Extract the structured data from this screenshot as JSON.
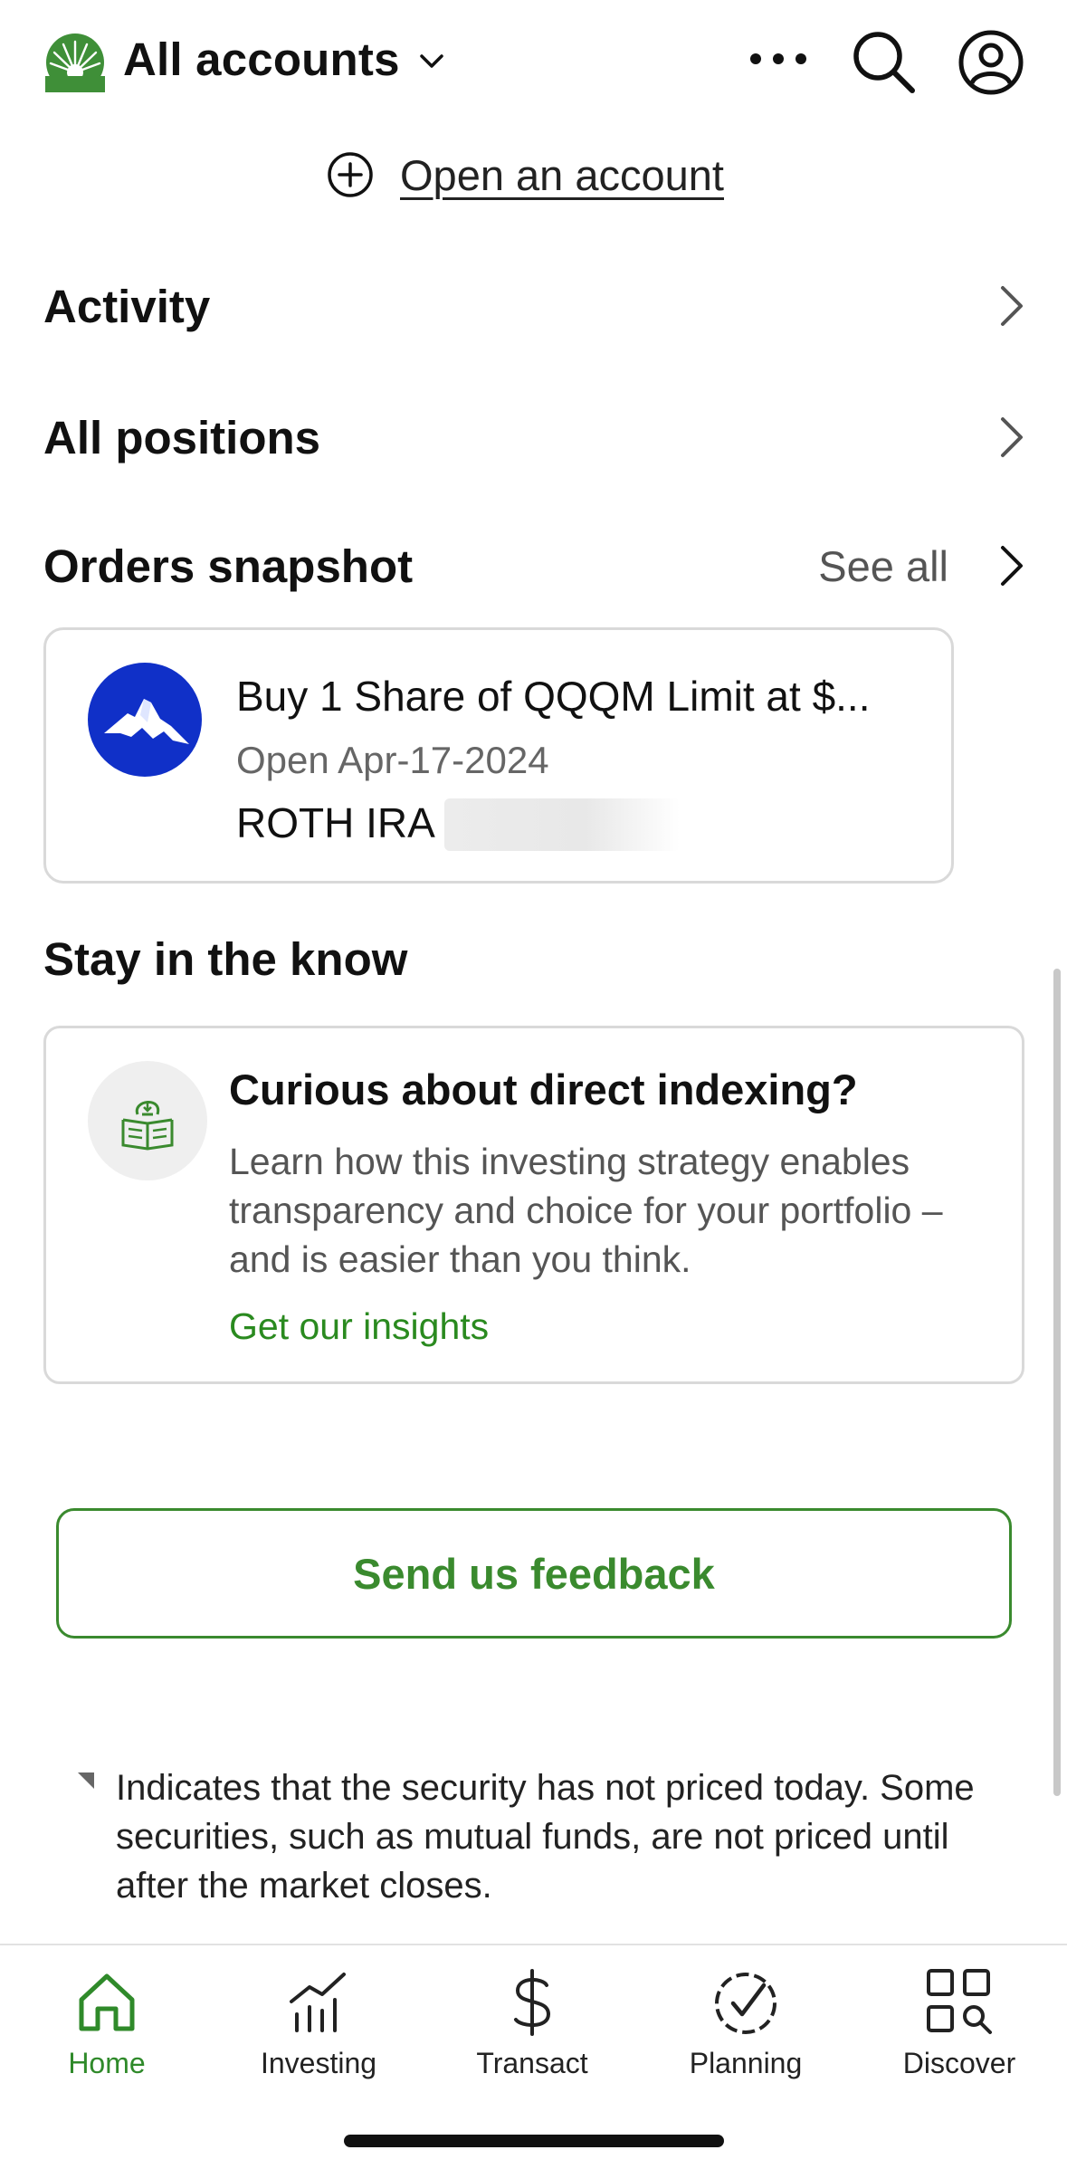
{
  "header": {
    "account_selector": "All accounts",
    "icons": [
      "logo-icon",
      "chevron-down-icon",
      "more-icon",
      "search-icon",
      "profile-icon"
    ]
  },
  "open_account": {
    "label": "Open an account"
  },
  "rows": {
    "activity": "Activity",
    "positions": "All positions",
    "orders": "Orders snapshot",
    "see_all": "See all"
  },
  "order": {
    "description": "Buy 1 Share of QQQM Limit at $...",
    "status": "Open Apr-17-2024",
    "account": "ROTH IRA"
  },
  "stay": {
    "title": "Stay in the know",
    "card_title": "Curious about direct indexing?",
    "card_body": "Learn how this investing strategy enables transparency and choice for your portfolio – and is easier than you think.",
    "card_link": "Get our insights"
  },
  "feedback": {
    "label": "Send us feedback"
  },
  "footnote": "Indicates that the security has not priced today. Some securities, such as mutual funds, are not priced until after the market closes.",
  "nav": {
    "home": "Home",
    "investing": "Investing",
    "transact": "Transact",
    "planning": "Planning",
    "discover": "Discover"
  },
  "colors": {
    "accent": "#3a8a2e",
    "fund_logo": "#1030c8",
    "text": "#111111",
    "muted": "#555555"
  }
}
